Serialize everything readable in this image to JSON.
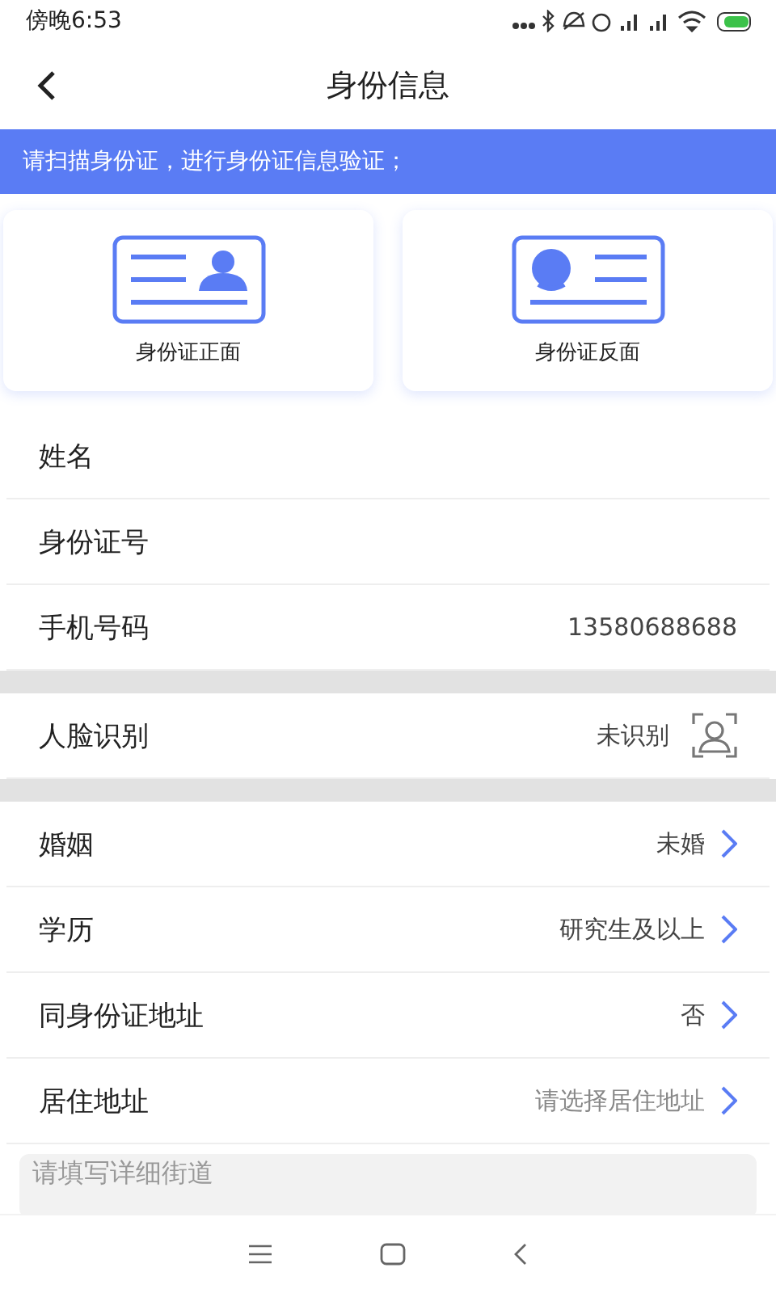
{
  "status_bar": {
    "time": "傍晚6:53"
  },
  "header": {
    "title": "身份信息"
  },
  "banner": {
    "text": "请扫描身份证，进行身份证信息验证；"
  },
  "id_cards": [
    {
      "kind": "front",
      "label": "身份证正面"
    },
    {
      "kind": "back",
      "label": "身份证反面"
    }
  ],
  "sections": [
    {
      "rows": [
        {
          "kind": "text",
          "label": "姓名"
        },
        {
          "kind": "text",
          "label": "身份证号"
        },
        {
          "kind": "text",
          "label": "手机号码",
          "value": "13580688688"
        }
      ]
    },
    {
      "rows": [
        {
          "kind": "face",
          "label": "人脸识别",
          "value": "未识别"
        }
      ]
    },
    {
      "rows": [
        {
          "kind": "select",
          "label": "婚姻",
          "value": "未婚",
          "placeholder": false
        },
        {
          "kind": "select",
          "label": "学历",
          "value": "研究生及以上",
          "placeholder": false
        },
        {
          "kind": "select",
          "label": "同身份证地址",
          "value": "否",
          "placeholder": false
        },
        {
          "kind": "select",
          "label": "居住地址",
          "value": "请选择居住地址",
          "placeholder": true
        }
      ]
    }
  ],
  "street_field": {
    "placeholder": "请填写详细街道"
  }
}
